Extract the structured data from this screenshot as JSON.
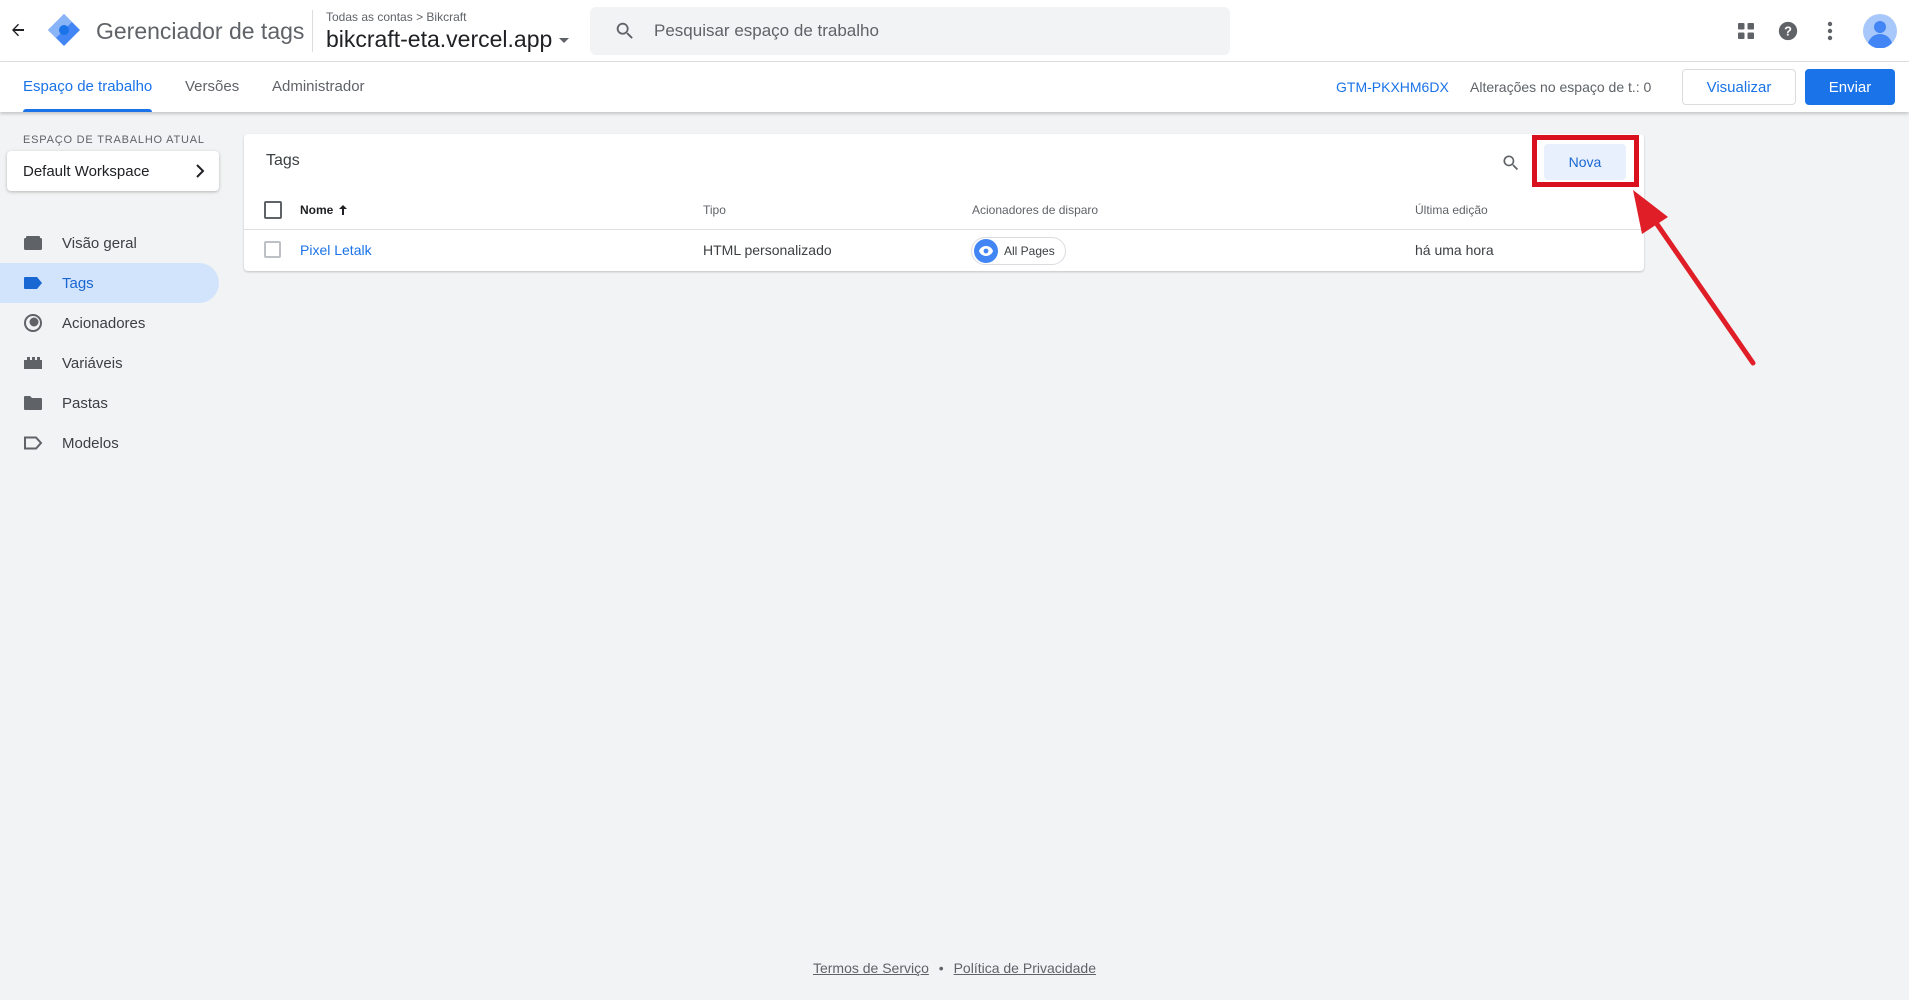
{
  "header": {
    "product_name": "Gerenciador de tags",
    "breadcrumb_accounts": "Todas as contas",
    "breadcrumb_separator": ">",
    "breadcrumb_account": "Bikcraft",
    "container_name": "bikcraft-eta.vercel.app",
    "search_placeholder": "Pesquisar espaço de trabalho",
    "icons": [
      "back-arrow-icon",
      "gtm-logo-icon",
      "search-icon",
      "apps-grid-icon",
      "help-icon",
      "more-vert-icon",
      "avatar-icon"
    ]
  },
  "subnav": {
    "tabs": [
      "Espaço de trabalho",
      "Versões",
      "Administrador"
    ],
    "active_tab": "Espaço de trabalho",
    "container_id": "GTM-PKXHM6DX",
    "changes_label": "Alterações no espaço de t.: 0",
    "preview_label": "Visualizar",
    "submit_label": "Enviar"
  },
  "sidebar": {
    "workspace_label": "ESPAÇO DE TRABALHO ATUAL",
    "workspace_name": "Default Workspace",
    "items": [
      {
        "label": "Visão geral",
        "icon": "overview-icon"
      },
      {
        "label": "Tags",
        "icon": "tag-icon",
        "active": true
      },
      {
        "label": "Acionadores",
        "icon": "trigger-icon"
      },
      {
        "label": "Variáveis",
        "icon": "variables-icon"
      },
      {
        "label": "Pastas",
        "icon": "folder-icon"
      },
      {
        "label": "Modelos",
        "icon": "template-icon"
      }
    ]
  },
  "tags_card": {
    "title": "Tags",
    "new_button": "Nova",
    "columns": [
      "Nome",
      "Tipo",
      "Acionadores de disparo",
      "Última edição"
    ],
    "rows": [
      {
        "name": "Pixel Letalk",
        "type": "HTML personalizado",
        "trigger": "All Pages",
        "last_edited": "há uma hora"
      }
    ]
  },
  "footer": {
    "terms": "Termos de Serviço",
    "separator": "•",
    "privacy": "Política de Privacidade"
  },
  "colors": {
    "accent": "#1a73e8",
    "active_nav_bg": "#d2e3fc",
    "highlight": "#d9101e"
  }
}
